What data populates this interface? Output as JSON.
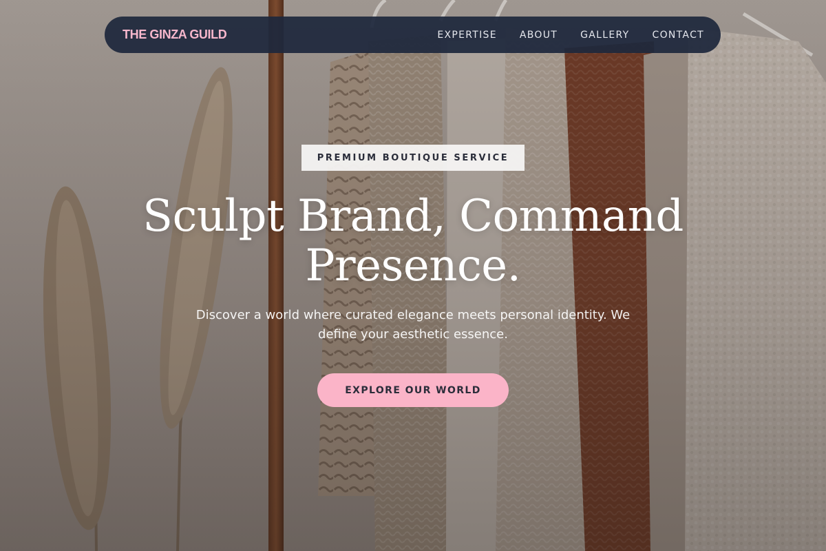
{
  "nav": {
    "brand": "THE GINZA GUILD",
    "links": [
      {
        "label": "EXPERTISE"
      },
      {
        "label": "ABOUT"
      },
      {
        "label": "GALLERY"
      },
      {
        "label": "CONTACT"
      }
    ]
  },
  "hero": {
    "tag": "PREMIUM BOUTIQUE SERVICE",
    "headline": "Sculpt Brand, Command Presence.",
    "subtext": "Discover a world where curated elegance meets personal identity. We define your aesthetic essence.",
    "cta_label": "EXPLORE OUR WORLD",
    "background": "clothing-rack-photo"
  },
  "colors": {
    "nav_bg": "#1e283c",
    "brand": "#f7b7cc",
    "cta_bg": "#fbb4c8",
    "cta_text": "#2b2d3a"
  }
}
